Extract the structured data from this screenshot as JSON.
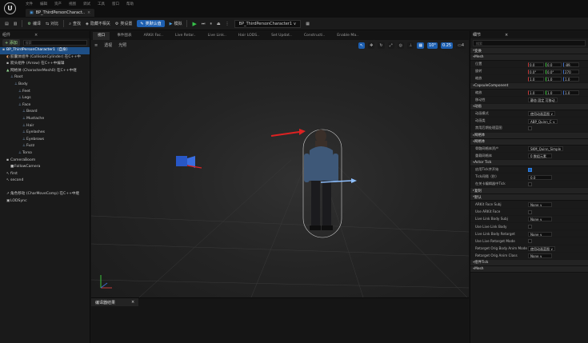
{
  "app": {
    "logo": "U",
    "tab_title": "BP_ThirdPersonCharact.."
  },
  "menus": [
    "文件",
    "编辑",
    "资产",
    "视图",
    "调试",
    "工具",
    "窗口",
    "帮助"
  ],
  "toolbar": {
    "compile": "编译",
    "diff": "对比",
    "find": "查找",
    "hide": "隐藏不相关",
    "class_settings": "类设置",
    "class_defaults": "类默认值",
    "simulate": "模拟",
    "debug_target": "BP_ThirdPersonCharacter1 ∨"
  },
  "components": {
    "header": "组件",
    "add": "+ 添加",
    "search_placeholder": "搜索",
    "items": [
      {
        "label": "BP_ThirdPersonCharacter1（自身）",
        "selected": true
      },
      {
        "label": "胶囊体组件 (CollisionCylinder)  在C++中"
      },
      {
        "label": "箭头组件 (Arrow)        在C++中编辑"
      },
      {
        "label": "网格体 (CharacterMesh0)  在C++中继"
      },
      {
        "label": "Root"
      },
      {
        "label": "Body"
      },
      {
        "label": "Feet"
      },
      {
        "label": "Legs"
      },
      {
        "label": "Face"
      },
      {
        "label": "Beard"
      },
      {
        "label": "Mustache"
      },
      {
        "label": "Hair"
      },
      {
        "label": "Eyelashes"
      },
      {
        "label": "Eyebrows"
      },
      {
        "label": "Fuzz"
      },
      {
        "label": "Torso"
      },
      {
        "label": "CameraBoom"
      },
      {
        "label": "FollowCamera"
      },
      {
        "label": "first"
      },
      {
        "label": "second"
      },
      {
        "label": ""
      },
      {
        "label": "角色移动 (CharMoveComp)  在C++中继"
      },
      {
        "label": "LODSync"
      }
    ]
  },
  "viewport_tabs": [
    "视口",
    "事件图表",
    "ARKit Fac..",
    "Live Retar..",
    "Live Link..",
    "Hair LODS..",
    "Set Updat..",
    "Constructi..",
    "Enable Ma.."
  ],
  "viewport": {
    "options": [
      "透视",
      "光照"
    ],
    "fov": "10°",
    "snap": "0.25",
    "cam_speed": "4"
  },
  "compiler": {
    "tab": "编译器结果"
  },
  "details": {
    "header": "细节",
    "search_placeholder": "搜索",
    "rows": [
      {
        "kind": "sec",
        "label": "变换"
      },
      {
        "kind": "sec",
        "label": "Mesh"
      },
      {
        "kind": "xf",
        "label": "位置",
        "values": [
          "0.0",
          "0.0",
          "-89."
        ]
      },
      {
        "kind": "xf",
        "label": "旋转",
        "values": [
          "0.0°",
          "0.0°",
          "270"
        ]
      },
      {
        "kind": "xf",
        "label": "缩放",
        "values": [
          "1.0",
          "1.0",
          "1.0"
        ]
      },
      {
        "kind": "sec",
        "label": "CapsuleComponent"
      },
      {
        "kind": "xf",
        "label": "缩放",
        "values": [
          "1.0",
          "1.0",
          "1.0"
        ]
      },
      {
        "kind": "text",
        "label": "移动性",
        "value": "静态    固定    可移动"
      },
      {
        "kind": "sec",
        "label": "动画"
      },
      {
        "kind": "val",
        "label": "动画模式",
        "value": "使用动画蓝图      ∨"
      },
      {
        "kind": "val",
        "label": "动画类",
        "value": "ABP_Quinn_C        ∨"
      },
      {
        "kind": "check",
        "label": "禁用后期处理蓝图",
        "on": false
      },
      {
        "kind": "sec",
        "label": "网格体",
        "collapsed": true
      },
      {
        "kind": "sec",
        "label": "网格体"
      },
      {
        "kind": "val",
        "label": "骨骼网格体资产",
        "value": "SKM_Quinn_Simple"
      },
      {
        "kind": "val",
        "label": "重载网格体",
        "value": "0 数组元素"
      },
      {
        "kind": "sec",
        "label": "Actor Tick"
      },
      {
        "kind": "check",
        "label": "启用Tick并开始",
        "on": true
      },
      {
        "kind": "val",
        "label": "Tick间隔（秒）",
        "value": "0.0"
      },
      {
        "kind": "check",
        "label": "在关卡编辑器中Tick",
        "on": false
      },
      {
        "kind": "sec",
        "label": "复制",
        "collapsed": true
      },
      {
        "kind": "sec",
        "label": "默认"
      },
      {
        "kind": "val",
        "label": "ARKit Face Subj",
        "value": "None            ∨"
      },
      {
        "kind": "check",
        "label": "Use ARKit Face",
        "on": false
      },
      {
        "kind": "val",
        "label": "Live Link Body Subj",
        "value": "None            ∨"
      },
      {
        "kind": "check",
        "label": "Use Live Link Body",
        "on": false
      },
      {
        "kind": "val",
        "label": "Live Link Body Retarget",
        "value": "None            ∨"
      },
      {
        "kind": "check",
        "label": "Use Live Retarget Mode",
        "on": false
      },
      {
        "kind": "val",
        "label": "Retarget Orig Body Anim Mode",
        "value": "使用动画蓝图      ∨"
      },
      {
        "kind": "val",
        "label": "Retarget Orig Anim Class",
        "value": "None            ∨"
      },
      {
        "kind": "sec",
        "label": "组件Tick"
      },
      {
        "kind": "sec",
        "label": "Mesh"
      }
    ]
  },
  "colors": {
    "accent": "#1d5fb0",
    "play": "#36c24a",
    "selected_row": "#1e4f86"
  }
}
